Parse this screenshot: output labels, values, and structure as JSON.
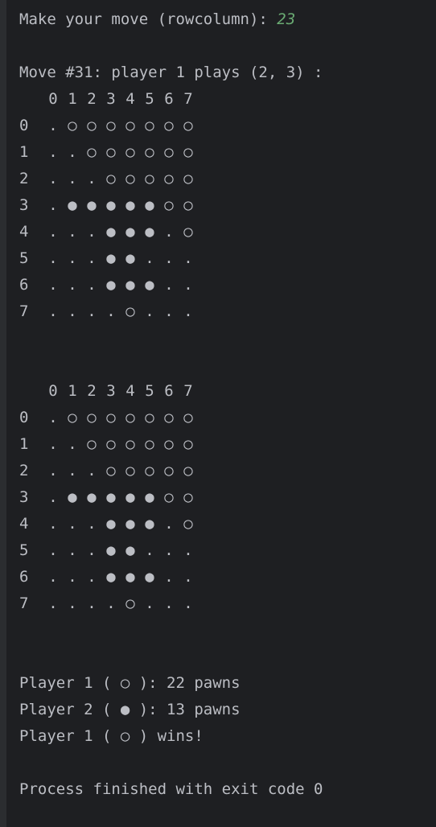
{
  "console": {
    "prompt_label": "Make your move (rowcolumn): ",
    "prompt_input": "23",
    "move_line": "Move #31: player 1 plays (2, 3) :",
    "column_headers": [
      "0",
      "1",
      "2",
      "3",
      "4",
      "5",
      "6",
      "7"
    ],
    "row_labels": [
      "0",
      "1",
      "2",
      "3",
      "4",
      "5",
      "6",
      "7"
    ],
    "boards": [
      {
        "rows": [
          [
            ".",
            "○",
            "○",
            "○",
            "○",
            "○",
            "○",
            "○"
          ],
          [
            ".",
            ".",
            "○",
            "○",
            "○",
            "○",
            "○",
            "○"
          ],
          [
            ".",
            ".",
            ".",
            "○",
            "○",
            "○",
            "○",
            "○"
          ],
          [
            ".",
            "●",
            "●",
            "●",
            "●",
            "●",
            "○",
            "○"
          ],
          [
            ".",
            ".",
            ".",
            "●",
            "●",
            "●",
            ".",
            "○"
          ],
          [
            ".",
            ".",
            ".",
            "●",
            "●",
            ".",
            ".",
            "."
          ],
          [
            ".",
            ".",
            ".",
            "●",
            "●",
            "●",
            ".",
            "."
          ],
          [
            ".",
            ".",
            ".",
            ".",
            "○",
            ".",
            ".",
            "."
          ]
        ]
      },
      {
        "rows": [
          [
            ".",
            "○",
            "○",
            "○",
            "○",
            "○",
            "○",
            "○"
          ],
          [
            ".",
            ".",
            "○",
            "○",
            "○",
            "○",
            "○",
            "○"
          ],
          [
            ".",
            ".",
            ".",
            "○",
            "○",
            "○",
            "○",
            "○"
          ],
          [
            ".",
            "●",
            "●",
            "●",
            "●",
            "●",
            "○",
            "○"
          ],
          [
            ".",
            ".",
            ".",
            "●",
            "●",
            "●",
            ".",
            "○"
          ],
          [
            ".",
            ".",
            ".",
            "●",
            "●",
            ".",
            ".",
            "."
          ],
          [
            ".",
            ".",
            ".",
            "●",
            "●",
            "●",
            ".",
            "."
          ],
          [
            ".",
            ".",
            ".",
            ".",
            "○",
            ".",
            ".",
            "."
          ]
        ]
      }
    ],
    "summary": [
      "Player 1 ( ○ ): 22 pawns",
      "Player 2 ( ● ): 13 pawns",
      "Player 1 ( ○ ) wins!"
    ],
    "exit_line": "Process finished with exit code 0"
  },
  "colors": {
    "background": "#1e1f22",
    "gutter": "#2b2d30",
    "text": "#bcbec4",
    "user_input": "#6aab73"
  }
}
